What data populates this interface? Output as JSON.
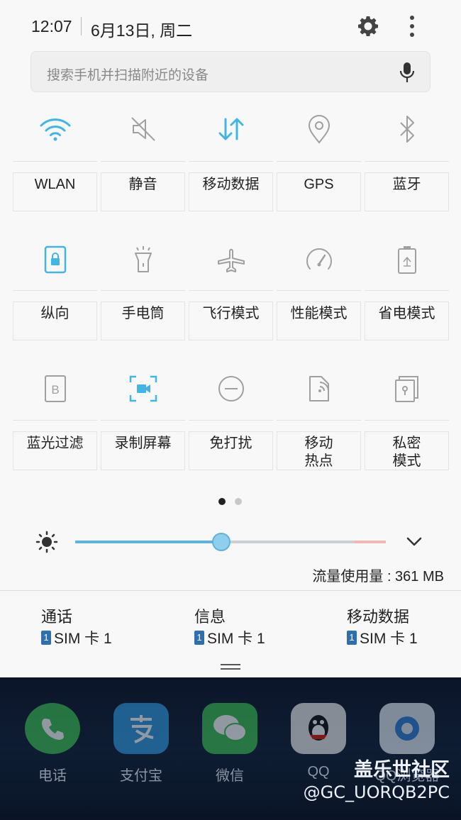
{
  "status_bar": {
    "time": "12:07",
    "date": "6月13日, 周二"
  },
  "search": {
    "placeholder": "搜索手机并扫描附近的设备"
  },
  "colors": {
    "accent": "#41b6e6",
    "inactive_icon": "#9a9a9a",
    "sim_badge": "#2f6fb0"
  },
  "quick_settings": {
    "rows": [
      [
        {
          "label": "WLAN",
          "icon": "wifi-icon",
          "active": true
        },
        {
          "label": "静音",
          "icon": "mute-icon",
          "active": false
        },
        {
          "label": "移动数据",
          "icon": "mobile-data-icon",
          "active": true
        },
        {
          "label": "GPS",
          "icon": "location-icon",
          "active": false
        },
        {
          "label": "蓝牙",
          "icon": "bluetooth-icon",
          "active": false
        }
      ],
      [
        {
          "label": "纵向",
          "icon": "portrait-lock-icon",
          "active": true
        },
        {
          "label": "手电筒",
          "icon": "flashlight-icon",
          "active": false
        },
        {
          "label": "飞行模式",
          "icon": "airplane-icon",
          "active": false
        },
        {
          "label": "性能模式",
          "icon": "performance-icon",
          "active": false
        },
        {
          "label": "省电模式",
          "icon": "power-saving-icon",
          "active": false
        }
      ],
      [
        {
          "label": "蓝光过滤",
          "icon": "blue-light-filter-icon",
          "active": false
        },
        {
          "label": "录制屏幕",
          "icon": "screen-record-icon",
          "active": true
        },
        {
          "label": "免打扰",
          "icon": "do-not-disturb-icon",
          "active": false
        },
        {
          "label": "移动\n热点",
          "icon": "hotspot-icon",
          "active": false
        },
        {
          "label": "私密\n模式",
          "icon": "private-mode-icon",
          "active": false
        }
      ]
    ],
    "page_indicator": {
      "pages": 2,
      "current": 1
    }
  },
  "brightness": {
    "level": 0.47
  },
  "data_usage": {
    "text": "流量使用量 : 361 MB"
  },
  "sim": [
    {
      "label": "通话",
      "badge": "1",
      "value": "SIM 卡 1"
    },
    {
      "label": "信息",
      "badge": "1",
      "value": "SIM 卡 1"
    },
    {
      "label": "移动数据",
      "badge": "1",
      "value": "SIM 卡 1"
    }
  ],
  "home": {
    "apps": [
      {
        "label": "电话",
        "icon": "phone-icon"
      },
      {
        "label": "支付宝",
        "icon": "alipay-icon"
      },
      {
        "label": "微信",
        "icon": "wechat-icon"
      },
      {
        "label": "QQ",
        "icon": "qq-icon"
      },
      {
        "label": "QQ浏览器",
        "icon": "qq-browser-icon"
      }
    ]
  },
  "watermark": {
    "line1": "盖乐世社区",
    "line2": "@GC_UORQB2PC"
  }
}
